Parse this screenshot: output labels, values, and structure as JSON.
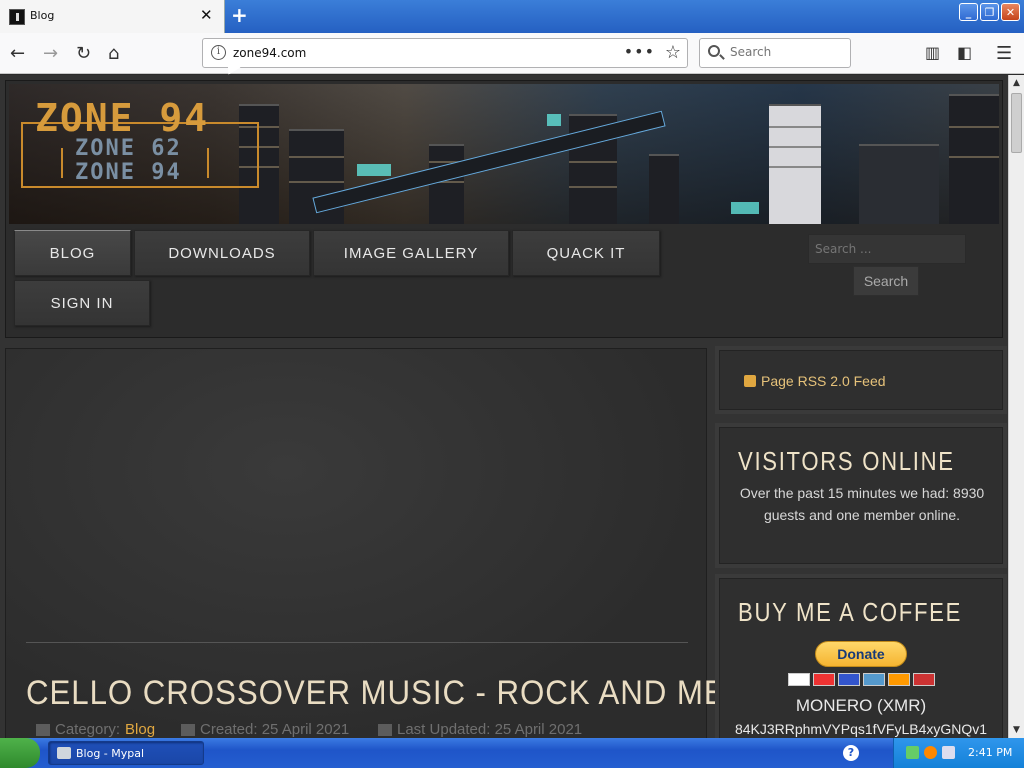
{
  "browser": {
    "tab_title": "Blog",
    "url": "zone94.com",
    "search_placeholder": "Search",
    "new_tab_symbol": "+",
    "close_tab_symbol": "✕",
    "page_actions_symbol": "•••",
    "info_symbol": "i"
  },
  "site": {
    "logo_main": "ZONE 94",
    "logo_sub1": "ZONE 62",
    "logo_sub2": "ZONE 94",
    "nav": [
      {
        "label": "BLOG"
      },
      {
        "label": "DOWNLOADS"
      },
      {
        "label": "IMAGE GALLERY"
      },
      {
        "label": "QUACK IT"
      },
      {
        "label": "SIGN IN"
      }
    ],
    "search_placeholder": "Search ...",
    "search_button": "Search"
  },
  "article": {
    "title": "CELLO CROSSOVER MUSIC - ROCK AND METAL",
    "category_label": "Category:",
    "category_value": "Blog",
    "created": "Created: 25 April 2021",
    "updated": "Last Updated: 25 April 2021"
  },
  "sidebar": {
    "rss": "Page RSS 2.0 Feed",
    "visitors_heading": "VISITORS ONLINE",
    "visitors_text": "Over the past 15 minutes we had: 8930 guests and one member online.",
    "coffee_heading": "BUY ME A COFFEE",
    "donate_label": "Donate",
    "monero_label": "MONERO (XMR)",
    "monero_address": "84KJ3RRphmVYPqs1fVFyLB4xyGNQv1"
  },
  "taskbar": {
    "task_label": "Blog - Mypal",
    "clock": "2:41 PM",
    "help_symbol": "?"
  },
  "colors": {
    "accent": "#e0a740",
    "title": "#e9dcc2",
    "taskbar": "#245ed0"
  }
}
